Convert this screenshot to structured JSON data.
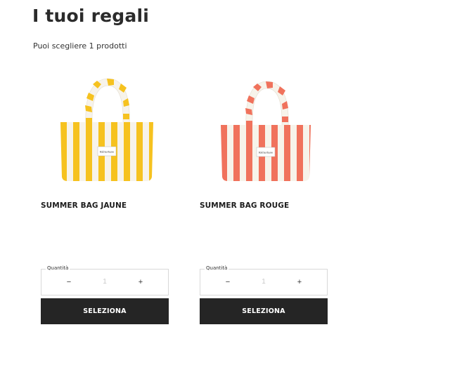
{
  "page": {
    "title": "I tuoi regali",
    "subtitle": "Puoi scegliere 1 prodotti"
  },
  "products": [
    {
      "name": "SUMMER BAG JAUNE",
      "quantity_label": "Quantità",
      "quantity_value": "1",
      "minus": "−",
      "plus": "+",
      "button_label": "SELEZIONA",
      "stripe_color": "#f6c21f",
      "tag_text": "Kérastase"
    },
    {
      "name": "SUMMER BAG ROUGE",
      "quantity_label": "Quantità",
      "quantity_value": "1",
      "minus": "−",
      "plus": "+",
      "button_label": "SELEZIONA",
      "stripe_color": "#f0725c",
      "tag_text": "Kérastase"
    }
  ]
}
